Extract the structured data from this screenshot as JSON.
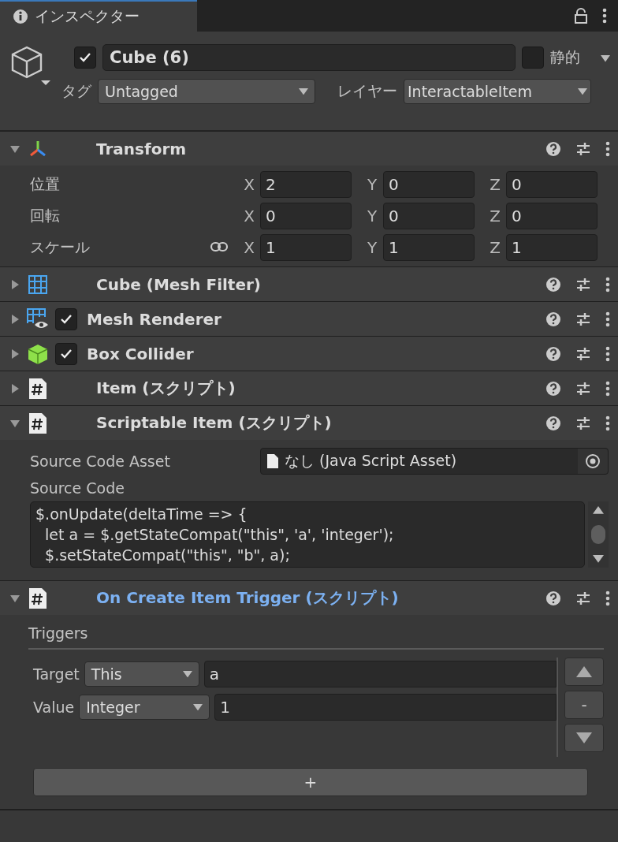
{
  "tab": {
    "title": "インスペクター",
    "selected": true
  },
  "object": {
    "active": true,
    "name": "Cube (6)",
    "static": false,
    "static_label": "静的",
    "tag_label": "タグ",
    "tag": "Untagged",
    "layer_label": "レイヤー",
    "layer": "InteractableItem"
  },
  "components": [
    {
      "kind": "transform",
      "title": "Transform",
      "expanded": true,
      "highlighted": false,
      "rows": [
        {
          "label": "位置",
          "linked": false,
          "fields": [
            {
              "axis": "X",
              "value": "2"
            },
            {
              "axis": "Y",
              "value": "0"
            },
            {
              "axis": "Z",
              "value": "0"
            }
          ]
        },
        {
          "label": "回転",
          "linked": false,
          "fields": [
            {
              "axis": "X",
              "value": "0"
            },
            {
              "axis": "Y",
              "value": "0"
            },
            {
              "axis": "Z",
              "value": "0"
            }
          ]
        },
        {
          "label": "スケール",
          "linked": true,
          "fields": [
            {
              "axis": "X",
              "value": "1"
            },
            {
              "axis": "Y",
              "value": "1"
            },
            {
              "axis": "Z",
              "value": "1"
            }
          ]
        }
      ]
    },
    {
      "kind": "meshfilter",
      "title": "Cube (Mesh Filter)",
      "expanded": false,
      "highlighted": false
    },
    {
      "kind": "meshrenderer",
      "title": "Mesh Renderer",
      "expanded": false,
      "highlighted": false,
      "enabled": true
    },
    {
      "kind": "collider",
      "title": "Box Collider",
      "expanded": false,
      "highlighted": false,
      "enabled": true
    },
    {
      "kind": "script",
      "title": "Item (スクリプト)",
      "expanded": false,
      "highlighted": false
    },
    {
      "kind": "script",
      "title": "Scriptable Item (スクリプト)",
      "expanded": true,
      "highlighted": false,
      "asset_label": "Source Code Asset",
      "asset_value": "なし (Java Script Asset)",
      "code_label": "Source Code",
      "code_lines": [
        "$.onUpdate(deltaTime => {",
        "  let a = $.getStateCompat(\"this\", 'a', 'integer');",
        "  $.setStateCompat(\"this\", \"b\", a);"
      ]
    },
    {
      "kind": "script",
      "title": "On Create Item Trigger (スクリプト)",
      "expanded": true,
      "highlighted": true,
      "list_label": "Triggers",
      "entries": [
        {
          "label": "Target",
          "dropdown": "This",
          "value": "a"
        },
        {
          "label": "Value",
          "dropdown": "Integer",
          "value": "1"
        }
      ],
      "remove_label": "-",
      "add_label": "+"
    }
  ]
}
